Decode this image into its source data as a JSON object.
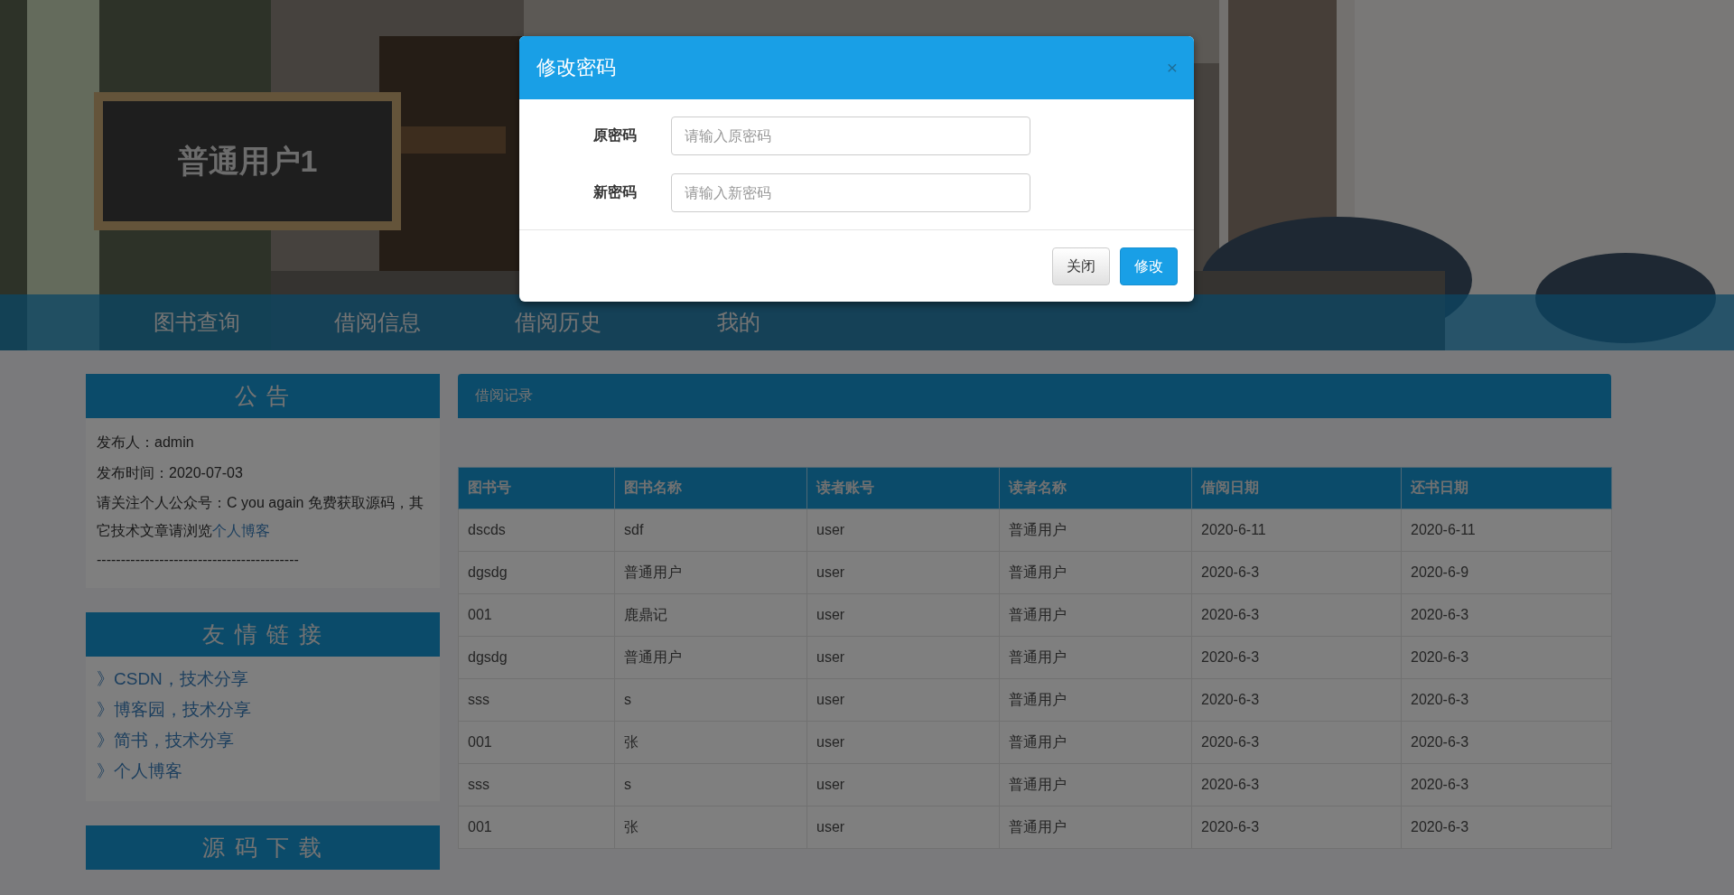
{
  "header": {
    "user_name": "普通用户1"
  },
  "nav": [
    {
      "label": "图书查询"
    },
    {
      "label": "借阅信息"
    },
    {
      "label": "借阅历史"
    },
    {
      "label": "我的"
    }
  ],
  "sidebar": [
    {
      "kind": "notice",
      "title": "公 告",
      "lines": [
        "发布人：admin",
        "发布时间：2020-07-03"
      ],
      "paragraph": "请关注个人公众号：C you again 免费获取源码，其它技术文章请浏览",
      "link": "个人博客",
      "rule": "------------------------------------------"
    },
    {
      "kind": "links",
      "title": "友 情 链 接",
      "links": [
        "》CSDN，技术分享",
        "》博客园，技术分享",
        "》简书，技术分享",
        "》个人博客"
      ]
    },
    {
      "kind": "download",
      "title": "源 码 下 载"
    }
  ],
  "records": {
    "title": "借阅记录",
    "columns": [
      "图书号",
      "图书名称",
      "读者账号",
      "读者名称",
      "借阅日期",
      "还书日期"
    ],
    "rows": [
      [
        "dscds",
        "sdf",
        "user",
        "普通用户",
        "2020-6-11",
        "2020-6-11"
      ],
      [
        "dgsdg",
        "普通用户",
        "user",
        "普通用户",
        "2020-6-3",
        "2020-6-9"
      ],
      [
        "001",
        "鹿鼎记",
        "user",
        "普通用户",
        "2020-6-3",
        "2020-6-3"
      ],
      [
        "dgsdg",
        "普通用户",
        "user",
        "普通用户",
        "2020-6-3",
        "2020-6-3"
      ],
      [
        "sss",
        "s",
        "user",
        "普通用户",
        "2020-6-3",
        "2020-6-3"
      ],
      [
        "001",
        "张",
        "user",
        "普通用户",
        "2020-6-3",
        "2020-6-3"
      ],
      [
        "sss",
        "s",
        "user",
        "普通用户",
        "2020-6-3",
        "2020-6-3"
      ],
      [
        "001",
        "张",
        "user",
        "普通用户",
        "2020-6-3",
        "2020-6-3"
      ]
    ]
  },
  "modal": {
    "title": "修改密码",
    "close": "×",
    "fields": [
      {
        "label": "原密码",
        "placeholder": "请输入原密码"
      },
      {
        "label": "新密码",
        "placeholder": "请输入新密码"
      }
    ],
    "buttons": [
      {
        "label": "关闭",
        "kind": "default"
      },
      {
        "label": "修改",
        "kind": "primary"
      }
    ]
  }
}
